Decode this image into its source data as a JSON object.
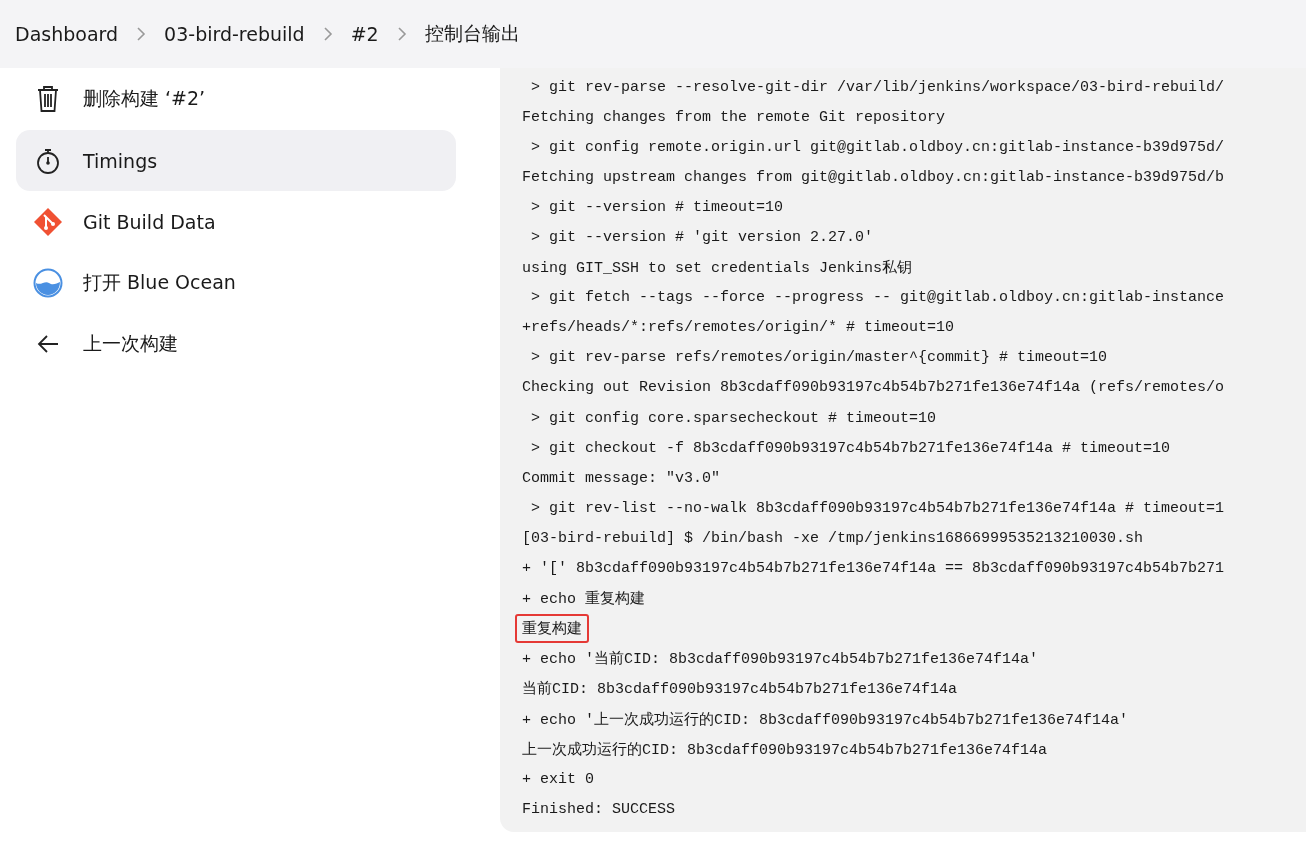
{
  "breadcrumb": [
    "Dashboard",
    "03-bird-rebuild",
    "#2",
    "控制台输出"
  ],
  "sidebar": {
    "items": [
      {
        "kind": "trash",
        "label": "删除构建 ‘#2’",
        "hovered": false
      },
      {
        "kind": "stopwatch",
        "label": "Timings",
        "hovered": true
      },
      {
        "kind": "git",
        "label": "Git Build Data",
        "hovered": false
      },
      {
        "kind": "ocean",
        "label": "打开 Blue Ocean",
        "hovered": false
      },
      {
        "kind": "back",
        "label": "上一次构建",
        "hovered": false
      }
    ]
  },
  "console": {
    "lines": [
      {
        "text": " > git rev-parse --resolve-git-dir /var/lib/jenkins/workspace/03-bird-rebuild/",
        "highlighted": false
      },
      {
        "text": "Fetching changes from the remote Git repository",
        "highlighted": false
      },
      {
        "text": " > git config remote.origin.url git@gitlab.oldboy.cn:gitlab-instance-b39d975d/",
        "highlighted": false
      },
      {
        "text": "Fetching upstream changes from git@gitlab.oldboy.cn:gitlab-instance-b39d975d/b",
        "highlighted": false
      },
      {
        "text": " > git --version # timeout=10",
        "highlighted": false
      },
      {
        "text": " > git --version # 'git version 2.27.0'",
        "highlighted": false
      },
      {
        "text": "using GIT_SSH to set credentials Jenkins私钥",
        "highlighted": false
      },
      {
        "text": " > git fetch --tags --force --progress -- git@gitlab.oldboy.cn:gitlab-instance",
        "highlighted": false
      },
      {
        "text": "+refs/heads/*:refs/remotes/origin/* # timeout=10",
        "highlighted": false
      },
      {
        "text": " > git rev-parse refs/remotes/origin/master^{commit} # timeout=10",
        "highlighted": false
      },
      {
        "text": "Checking out Revision 8b3cdaff090b93197c4b54b7b271fe136e74f14a (refs/remotes/o",
        "highlighted": false
      },
      {
        "text": " > git config core.sparsecheckout # timeout=10",
        "highlighted": false
      },
      {
        "text": " > git checkout -f 8b3cdaff090b93197c4b54b7b271fe136e74f14a # timeout=10",
        "highlighted": false
      },
      {
        "text": "Commit message: \"v3.0\"",
        "highlighted": false
      },
      {
        "text": " > git rev-list --no-walk 8b3cdaff090b93197c4b54b7b271fe136e74f14a # timeout=1",
        "highlighted": false
      },
      {
        "text": "[03-bird-rebuild] $ /bin/bash -xe /tmp/jenkins16866999535213210030.sh",
        "highlighted": false
      },
      {
        "text": "+ '[' 8b3cdaff090b93197c4b54b7b271fe136e74f14a == 8b3cdaff090b93197c4b54b7b271",
        "highlighted": false
      },
      {
        "text": "+ echo 重复构建",
        "highlighted": false
      },
      {
        "text": "重复构建",
        "highlighted": true
      },
      {
        "text": "+ echo '当前CID: 8b3cdaff090b93197c4b54b7b271fe136e74f14a'",
        "highlighted": false
      },
      {
        "text": "当前CID: 8b3cdaff090b93197c4b54b7b271fe136e74f14a",
        "highlighted": false
      },
      {
        "text": "+ echo '上一次成功运行的CID: 8b3cdaff090b93197c4b54b7b271fe136e74f14a'",
        "highlighted": false
      },
      {
        "text": "上一次成功运行的CID: 8b3cdaff090b93197c4b54b7b271fe136e74f14a",
        "highlighted": false
      },
      {
        "text": "+ exit 0",
        "highlighted": false
      },
      {
        "text": "Finished: SUCCESS",
        "highlighted": false
      }
    ]
  }
}
